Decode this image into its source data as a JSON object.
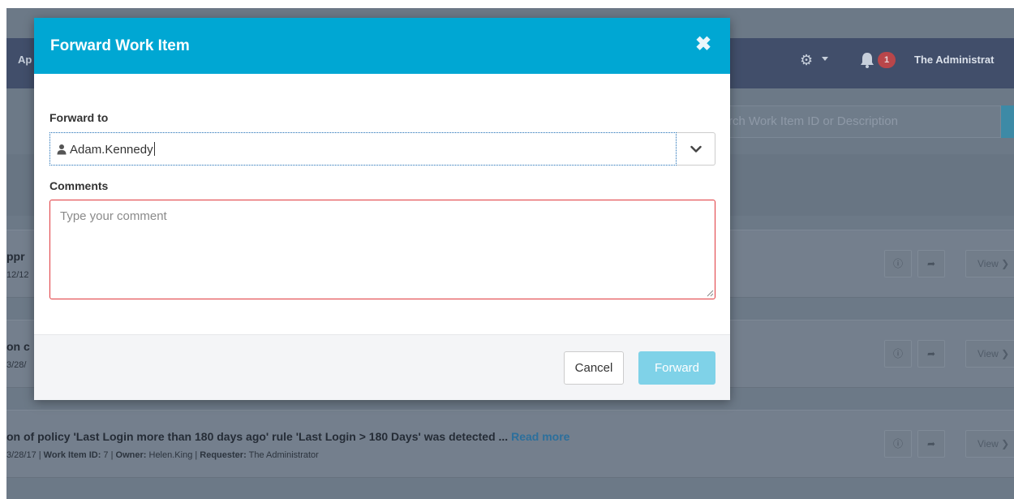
{
  "background": {
    "nav": {
      "left_label": "Ap",
      "settings_icon": "gear-icon",
      "notifications_icon": "bell-icon",
      "notification_count": "1",
      "user_name": "The Administrat"
    },
    "search": {
      "placeholder_visible": "rch Work Item ID or Description"
    },
    "rows": [
      {
        "title": "ppr",
        "meta": "12/12",
        "view_label": "View"
      },
      {
        "title": "on c",
        "meta": "3/28/",
        "view_label": "View"
      },
      {
        "title": "on of policy 'Last Login more than 180 days ago' rule 'Last Login > 180 Days' was detected ...",
        "read_more": "Read more",
        "meta_date": "3/28/17 | ",
        "meta_id_label": "Work Item ID:",
        "meta_id": " 7 | ",
        "meta_owner_label": "Owner:",
        "meta_owner": " Helen.King | ",
        "meta_requester_label": "Requester:",
        "meta_requester": " The Administrator",
        "view_label": "View"
      }
    ]
  },
  "modal": {
    "title": "Forward Work Item",
    "close_icon": "close-icon",
    "forward_to_label": "Forward to",
    "forward_to_value": "Adam.Kennedy",
    "comments_label": "Comments",
    "comments_placeholder": "Type your comment",
    "cancel_label": "Cancel",
    "forward_label": "Forward"
  },
  "colors": {
    "header": "#00a7d3",
    "forward_button": "#7fd2e8",
    "comments_border_error": "#e0393e",
    "navbar": "#414e6a",
    "badge": "#b9464a",
    "link": "#2c6f9c"
  }
}
